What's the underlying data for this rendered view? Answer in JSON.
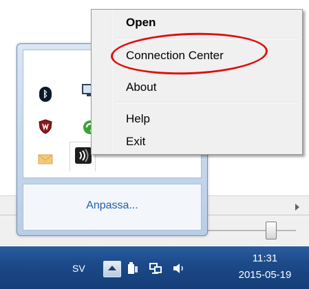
{
  "context_menu": {
    "items": [
      {
        "label": "Open",
        "bold": true
      },
      {
        "label": "Connection Center",
        "highlighted": true
      },
      {
        "label": "About"
      },
      {
        "label": "Help"
      },
      {
        "label": "Exit"
      }
    ]
  },
  "tray_flyout": {
    "icons": [
      "bluetooth-icon",
      "monitor-icon",
      "security-shield-icon",
      "green-sync-icon",
      "mail-icon",
      "wireless-receiver-icon"
    ],
    "customize_link": "Anpassa..."
  },
  "taskbar": {
    "language": "SV",
    "time": "11:31",
    "date": "2015-05-19"
  },
  "colors": {
    "annotation": "#e00d0d",
    "taskbar": "#1c4a89",
    "link": "#1f5fa8"
  }
}
